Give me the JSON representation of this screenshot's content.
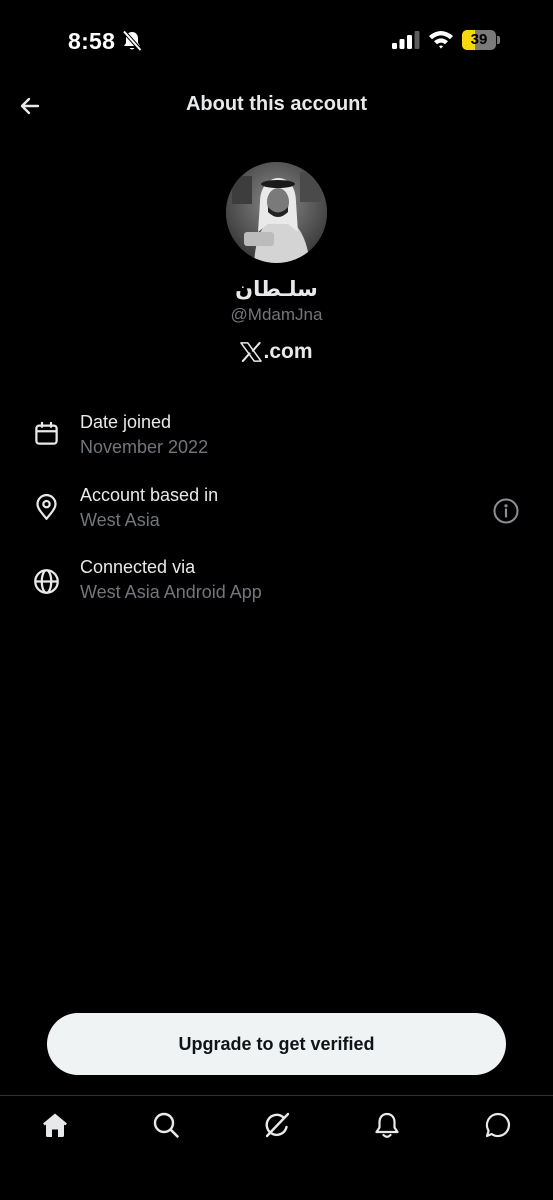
{
  "status_bar": {
    "time": "8:58",
    "battery_level": 39,
    "battery_text": "39",
    "icons": [
      "bell-off-icon",
      "cellular-signal-icon",
      "wifi-icon",
      "battery-icon"
    ]
  },
  "header": {
    "back_icon": "arrow-left-icon",
    "title": "About this account"
  },
  "profile": {
    "display_name": "سلـطان",
    "handle": "@MdamJna",
    "site": ".com",
    "site_logo_icon": "x-logo-icon"
  },
  "details": [
    {
      "icon": "calendar-icon",
      "label": "Date joined",
      "value": "November 2022"
    },
    {
      "icon": "location-pin-icon",
      "label": "Account based in",
      "value": "West Asia",
      "action_icon": "info-icon"
    },
    {
      "icon": "globe-icon",
      "label": "Connected via",
      "value": "West Asia Android App"
    }
  ],
  "upgrade_button": {
    "label": "Upgrade to get verified"
  },
  "bottom_nav": {
    "items": [
      {
        "icon": "home-icon",
        "active": true
      },
      {
        "icon": "search-icon"
      },
      {
        "icon": "grok-icon"
      },
      {
        "icon": "bell-icon"
      },
      {
        "icon": "chat-icon"
      }
    ]
  },
  "colors": {
    "background": "#000000",
    "text_primary": "#e7e9ea",
    "text_secondary": "#71767b",
    "button_background": "#eff3f4",
    "battery_fill": "#f5d90a"
  }
}
